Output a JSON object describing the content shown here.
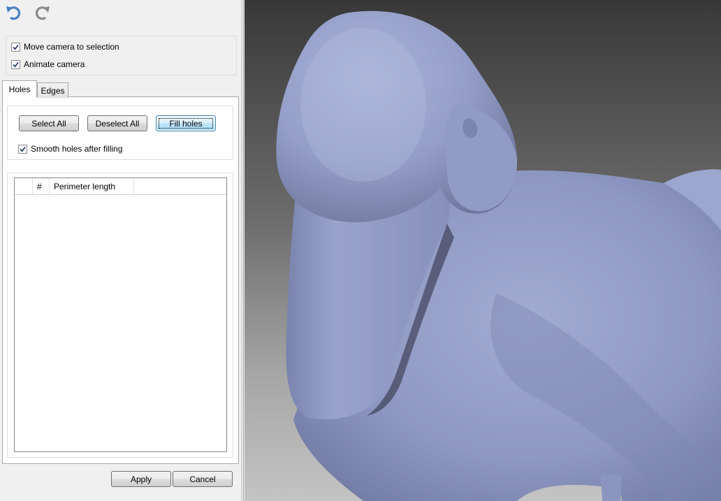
{
  "toolbar": {
    "undo_icon": "undo-arrow-icon",
    "redo_icon": "redo-arrow-icon"
  },
  "camera": {
    "move_camera_label": "Move camera to selection",
    "move_camera_checked": true,
    "animate_camera_label": "Animate camera",
    "animate_camera_checked": true
  },
  "tabs": [
    {
      "label": "Holes",
      "active": true
    },
    {
      "label": "Edges",
      "active": false
    }
  ],
  "holes": {
    "select_all_label": "Select All",
    "deselect_all_label": "Deselect All",
    "fill_holes_label": "Fill holes",
    "smooth_label": "Smooth holes after filling",
    "smooth_checked": true
  },
  "holes_table": {
    "columns": [
      "",
      "#",
      "Perimeter length"
    ],
    "rows": []
  },
  "footer": {
    "apply_label": "Apply",
    "cancel_label": "Cancel"
  },
  "viewport": {
    "model": "3D duck mesh",
    "model_color": "#9aa3cc"
  },
  "colors": {
    "icon_blue": "#4a7fc1",
    "icon_gray": "#8a8a8a",
    "focus_border": "#3c7fb1"
  }
}
